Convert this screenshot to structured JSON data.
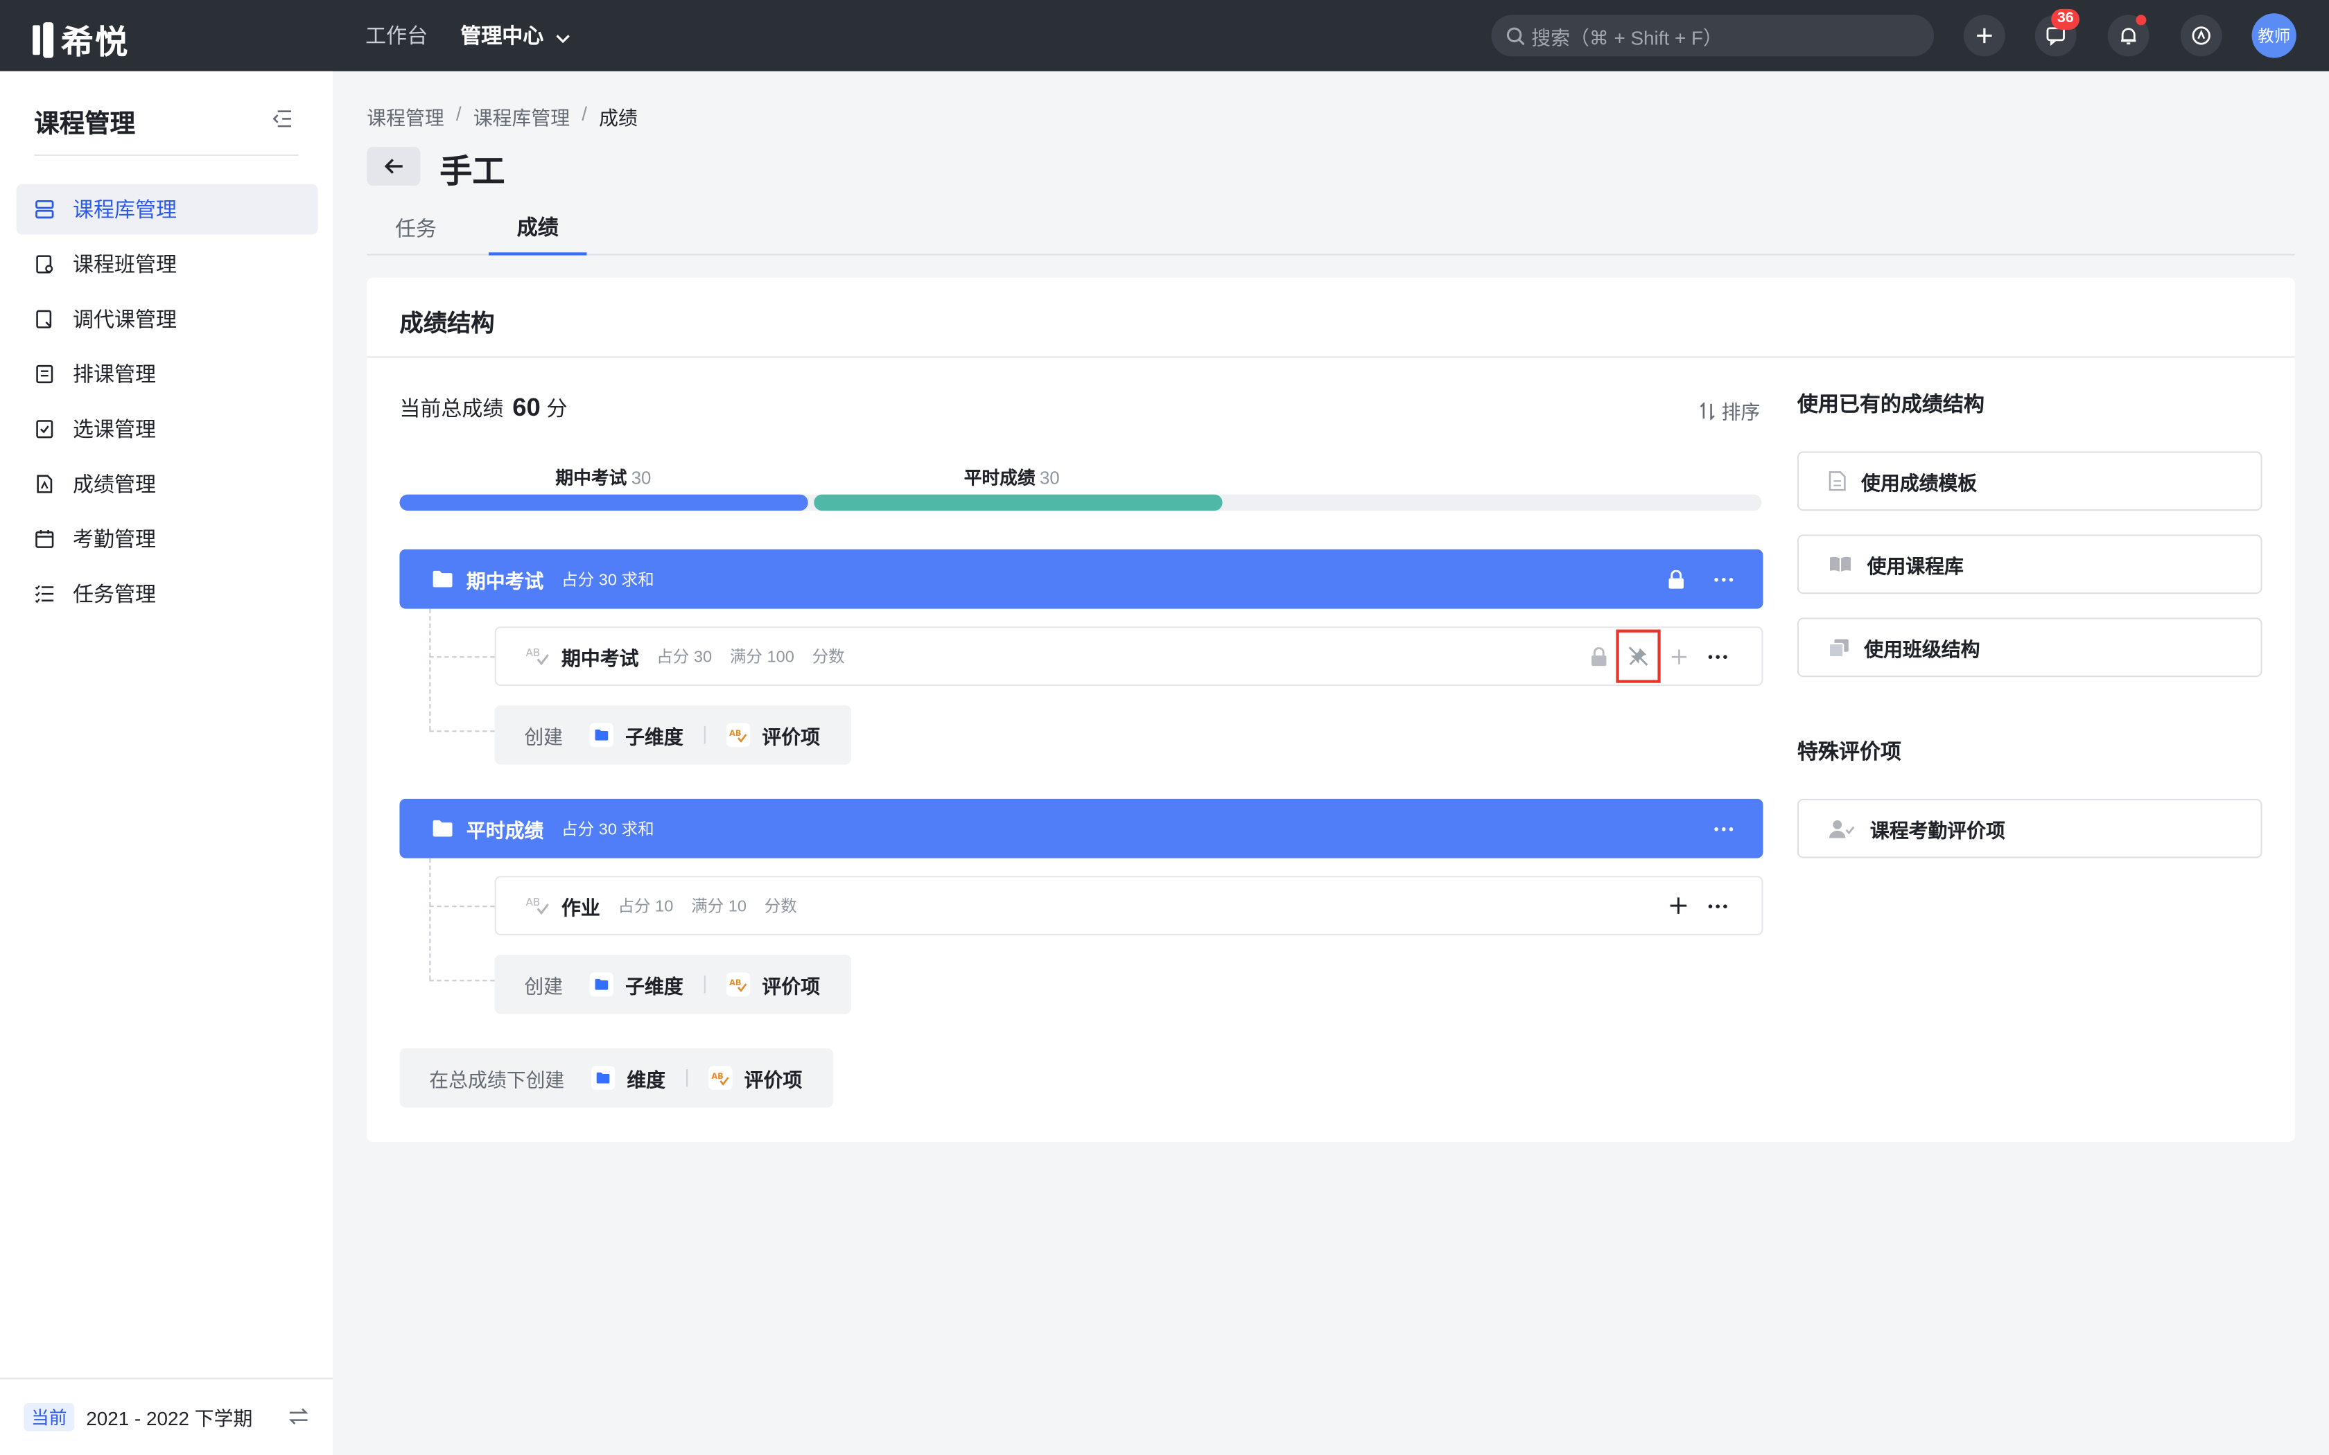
{
  "app": {
    "logo_text": "希悦"
  },
  "topnav": {
    "workbench": "工作台",
    "admin_center": "管理中心"
  },
  "search": {
    "placeholder": "搜索（⌘ + Shift + F）"
  },
  "header_icons": {
    "message_badge": "36",
    "avatar_text": "教师"
  },
  "sidebar": {
    "title": "课程管理",
    "items": [
      {
        "label": "课程库管理",
        "icon": "database-icon",
        "active": true
      },
      {
        "label": "课程班管理",
        "icon": "class-icon"
      },
      {
        "label": "调代课管理",
        "icon": "swap-icon"
      },
      {
        "label": "排课管理",
        "icon": "schedule-icon"
      },
      {
        "label": "选课管理",
        "icon": "checklist-icon"
      },
      {
        "label": "成绩管理",
        "icon": "grade-icon"
      },
      {
        "label": "考勤管理",
        "icon": "calendar-icon"
      },
      {
        "label": "任务管理",
        "icon": "task-list-icon"
      }
    ],
    "footer": {
      "tag": "当前",
      "term": "2021 - 2022 下学期"
    }
  },
  "breadcrumb": {
    "items": [
      "课程管理",
      "课程库管理",
      "成绩"
    ]
  },
  "page": {
    "title": "手工"
  },
  "tabs": [
    {
      "label": "任务"
    },
    {
      "label": "成绩",
      "active": true
    }
  ],
  "card": {
    "title": "成绩结构",
    "total_label": "当前总成绩",
    "total_value": "60",
    "total_unit": "分",
    "sort_label": "排序",
    "progress": [
      {
        "label": "期中考试",
        "value": "30",
        "fraction": 0.3,
        "color": "#4f7ef8"
      },
      {
        "label": "平时成绩",
        "value": "30",
        "fraction": 0.3,
        "color": "#4fb8a6"
      }
    ],
    "groups": [
      {
        "name": "期中考试",
        "meta": "占分 30 求和",
        "locked": true,
        "items": [
          {
            "name": "期中考试",
            "weight": "占分 30",
            "full": "满分 100",
            "type": "分数"
          }
        ]
      },
      {
        "name": "平时成绩",
        "meta": "占分 30 求和",
        "locked": false,
        "items": [
          {
            "name": "作业",
            "weight": "占分 10",
            "full": "满分 10",
            "type": "分数"
          }
        ]
      }
    ],
    "create": {
      "label": "创建",
      "sub_dim": "子维度",
      "eval_item": "评价项"
    },
    "root_create": {
      "label": "在总成绩下创建",
      "dim": "维度",
      "eval_item": "评价项"
    }
  },
  "right": {
    "existing_title": "使用已有的成绩结构",
    "buttons": [
      "使用成绩模板",
      "使用课程库",
      "使用班级结构"
    ],
    "special_title": "特殊评价项",
    "special_buttons": [
      "课程考勤评价项"
    ]
  },
  "colors": {
    "accent": "#3370ff",
    "group_bar": "#4f7ef8",
    "teal": "#4fb8a6",
    "highlight": "#e5362c"
  }
}
